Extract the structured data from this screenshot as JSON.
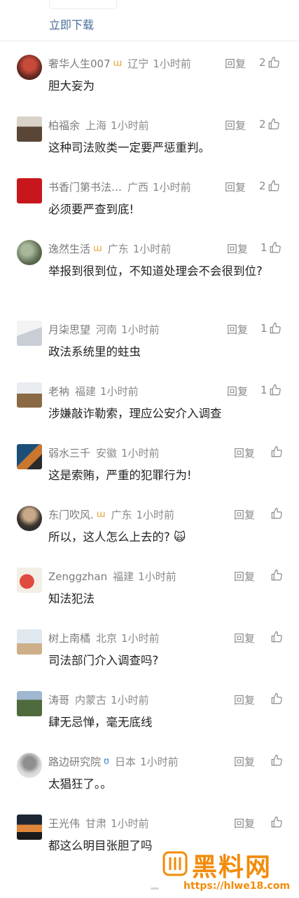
{
  "header": {
    "download_label": "立即下载"
  },
  "comments": [
    {
      "name": "奢华人生007",
      "badge": "gold",
      "location": "辽宁",
      "time": "1小时前",
      "reply": "回复",
      "likes": "2",
      "text": "胆大妄为"
    },
    {
      "name": "柏福余",
      "badge": "",
      "location": "上海",
      "time": "1小时前",
      "reply": "回复",
      "likes": "2",
      "text": "这种司法败类一定要严惩重判。"
    },
    {
      "name": "书香门第书法…",
      "badge": "",
      "location": "广西",
      "time": "1小时前",
      "reply": "回复",
      "likes": "2",
      "text": "必须要严查到底!"
    },
    {
      "name": "逸然生活",
      "badge": "gold",
      "location": "广东",
      "time": "1小时前",
      "reply": "回复",
      "likes": "1",
      "text": "举报到很到位，不知道处理会不会很到位?"
    },
    {
      "name": "月柒思望",
      "badge": "",
      "location": "河南",
      "time": "1小时前",
      "reply": "回复",
      "likes": "1",
      "text": "政法系统里的蛀虫"
    },
    {
      "name": "老衲",
      "badge": "",
      "location": "福建",
      "time": "1小时前",
      "reply": "回复",
      "likes": "1",
      "text": "涉嫌敲诈勒索，理应公安介入调查"
    },
    {
      "name": "弱水三千",
      "badge": "",
      "location": "安徽",
      "time": "1小时前",
      "reply": "回复",
      "likes": "",
      "text": "这是索贿，严重的犯罪行为!"
    },
    {
      "name": "东门吹风.",
      "badge": "gold",
      "location": "广东",
      "time": "1小时前",
      "reply": "回复",
      "likes": "",
      "text": "所以，这人怎么上去的? 🙀"
    },
    {
      "name": "Zenggzhan",
      "badge": "",
      "location": "福建",
      "time": "1小时前",
      "reply": "回复",
      "likes": "",
      "text": "知法犯法"
    },
    {
      "name": "树上南橘",
      "badge": "",
      "location": "北京",
      "time": "1小时前",
      "reply": "回复",
      "likes": "",
      "text": "司法部门介入调查吗?"
    },
    {
      "name": "涛哥",
      "badge": "",
      "location": "内蒙古",
      "time": "1小时前",
      "reply": "回复",
      "likes": "",
      "text": "肆无忌惮，毫无底线"
    },
    {
      "name": "路边研究院",
      "badge": "blue",
      "location": "日本",
      "time": "1小时前",
      "reply": "回复",
      "likes": "",
      "text": "太猖狂了。。"
    },
    {
      "name": "王光伟",
      "badge": "",
      "location": "甘肃",
      "time": "1小时前",
      "reply": "回复",
      "likes": "",
      "text": "都这么明目张胆了吗"
    }
  ],
  "watermark": {
    "title": "黑料网",
    "url": "https://hlwe18.com"
  },
  "colors": {
    "link": "#4a6c9a",
    "meta": "#8a8a8a",
    "text": "#222222",
    "watermark": "#f28b0a",
    "badge_gold": "#e0a431",
    "badge_blue": "#3b86d8"
  }
}
